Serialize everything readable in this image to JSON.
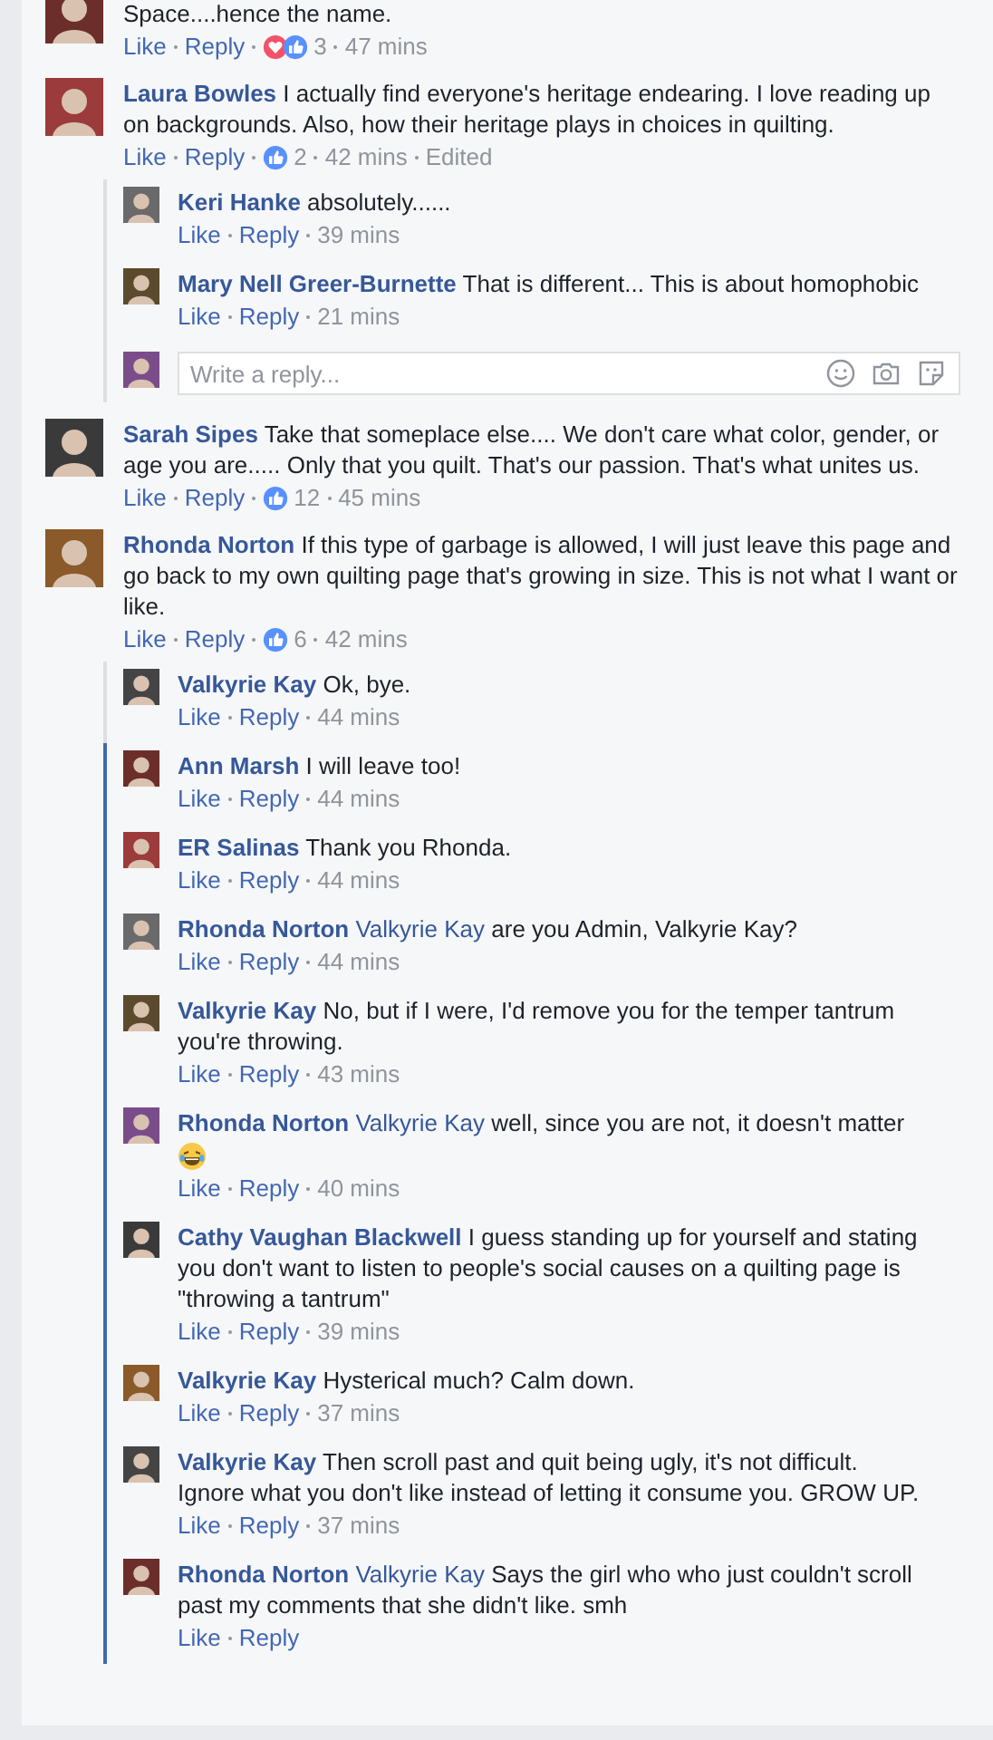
{
  "comments": [
    {
      "text": "Space....hence the name.",
      "actions": [
        "Like",
        "Reply"
      ],
      "reactions": [
        {
          "kind": "love"
        },
        {
          "kind": "like"
        }
      ],
      "reaction_count": "3",
      "time": "47 mins"
    },
    {
      "author": "Laura Bowles",
      "text": "I actually find everyone's heritage endearing. I love reading up on backgrounds. Also, how their heritage plays in choices in quilting.",
      "actions": [
        "Like",
        "Reply"
      ],
      "reactions": [
        {
          "kind": "like"
        }
      ],
      "reaction_count": "2",
      "time": "42 mins",
      "edited": "Edited",
      "replies": [
        {
          "author": "Keri Hanke",
          "text": "absolutely......",
          "actions": [
            "Like",
            "Reply"
          ],
          "time": "39 mins",
          "highlighted": false
        },
        {
          "author": "Mary Nell Greer-Burnette",
          "text": "That is different... This is about homophobic",
          "actions": [
            "Like",
            "Reply"
          ],
          "time": "21 mins",
          "highlighted": false
        }
      ],
      "reply_box": {
        "placeholder": "Write a reply..."
      }
    },
    {
      "author": "Sarah Sipes",
      "text": "Take that someplace else.... We don't care what color, gender, or age you are..... Only that you quilt. That's our passion. That's what unites us.",
      "actions": [
        "Like",
        "Reply"
      ],
      "reactions": [
        {
          "kind": "like"
        }
      ],
      "reaction_count": "12",
      "time": "45 mins"
    },
    {
      "author": "Rhonda Norton",
      "text": "If this type of garbage is allowed, I will just leave this page and go back to my own quilting page that's growing in size. This is not what I want or like.",
      "actions": [
        "Like",
        "Reply"
      ],
      "reactions": [
        {
          "kind": "like"
        }
      ],
      "reaction_count": "6",
      "time": "42 mins",
      "replies": [
        {
          "author": "Valkyrie Kay",
          "text": "Ok, bye.",
          "actions": [
            "Like",
            "Reply"
          ],
          "time": "44 mins",
          "highlighted": false
        },
        {
          "author": "Ann Marsh",
          "text": "I will leave too!",
          "actions": [
            "Like",
            "Reply"
          ],
          "time": "44 mins",
          "highlighted": true
        },
        {
          "author": "ER Salinas",
          "text": "Thank you Rhonda.",
          "actions": [
            "Like",
            "Reply"
          ],
          "time": "44 mins",
          "highlighted": true
        },
        {
          "author": "Rhonda Norton",
          "mention": "Valkyrie Kay",
          "text": "are you Admin, Valkyrie Kay?",
          "actions": [
            "Like",
            "Reply"
          ],
          "time": "44 mins",
          "highlighted": true
        },
        {
          "author": "Valkyrie Kay",
          "text": "No, but if I were, I'd remove you for the temper tantrum you're throwing.",
          "actions": [
            "Like",
            "Reply"
          ],
          "time": "43 mins",
          "highlighted": true
        },
        {
          "author": "Rhonda Norton",
          "mention": "Valkyrie Kay",
          "text": "well, since you are not, it doesn't matter",
          "emoji": {
            "kind": "laughing"
          },
          "actions": [
            "Like",
            "Reply"
          ],
          "time": "40 mins",
          "highlighted": true
        },
        {
          "author": "Cathy Vaughan Blackwell",
          "text": "I guess standing up for yourself and stating you don't want to listen to people's social causes on a quilting page is \"throwing a tantrum\"",
          "actions": [
            "Like",
            "Reply"
          ],
          "time": "39 mins",
          "highlighted": true
        },
        {
          "author": "Valkyrie Kay",
          "text": "Hysterical much? Calm down.",
          "actions": [
            "Like",
            "Reply"
          ],
          "time": "37 mins",
          "highlighted": true
        },
        {
          "author": "Valkyrie Kay",
          "text": "Then scroll past and quit being ugly, it's not difficult. Ignore what you don't like instead of letting it consume you. GROW UP.",
          "actions": [
            "Like",
            "Reply"
          ],
          "time": "37 mins",
          "highlighted": true
        },
        {
          "author": "Rhonda Norton",
          "mention": "Valkyrie Kay",
          "text": "Says the girl who who just couldn't scroll past my comments that she didn't like. smh",
          "actions": [
            "Like",
            "Reply"
          ],
          "highlighted": true
        }
      ]
    }
  ]
}
